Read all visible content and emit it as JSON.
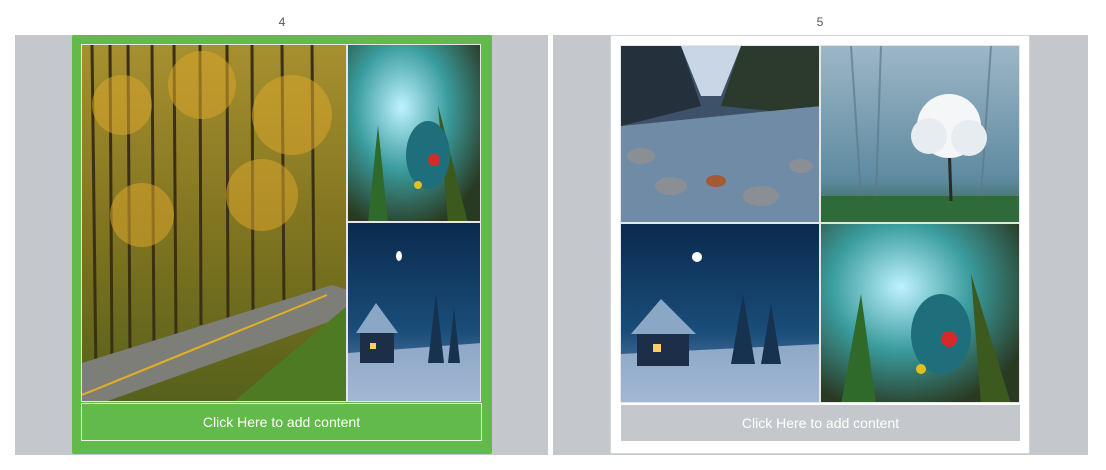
{
  "layouts": [
    {
      "label": "4",
      "state": "selected",
      "photos": [
        "forest-road-photo",
        "peacock-fantasy-photo",
        "moonlit-cabin-photo"
      ],
      "add_content_label": "Click Here to add content"
    },
    {
      "label": "5",
      "state": "unselected",
      "photos": [
        "mountain-river-photo",
        "misty-white-tree-photo",
        "moonlit-cabin-photo",
        "peacock-fantasy-photo"
      ],
      "add_content_label": "Click Here to add content"
    }
  ],
  "colors": {
    "selected_accent": "#62ba4b",
    "panel_background": "#c4c8cc"
  }
}
